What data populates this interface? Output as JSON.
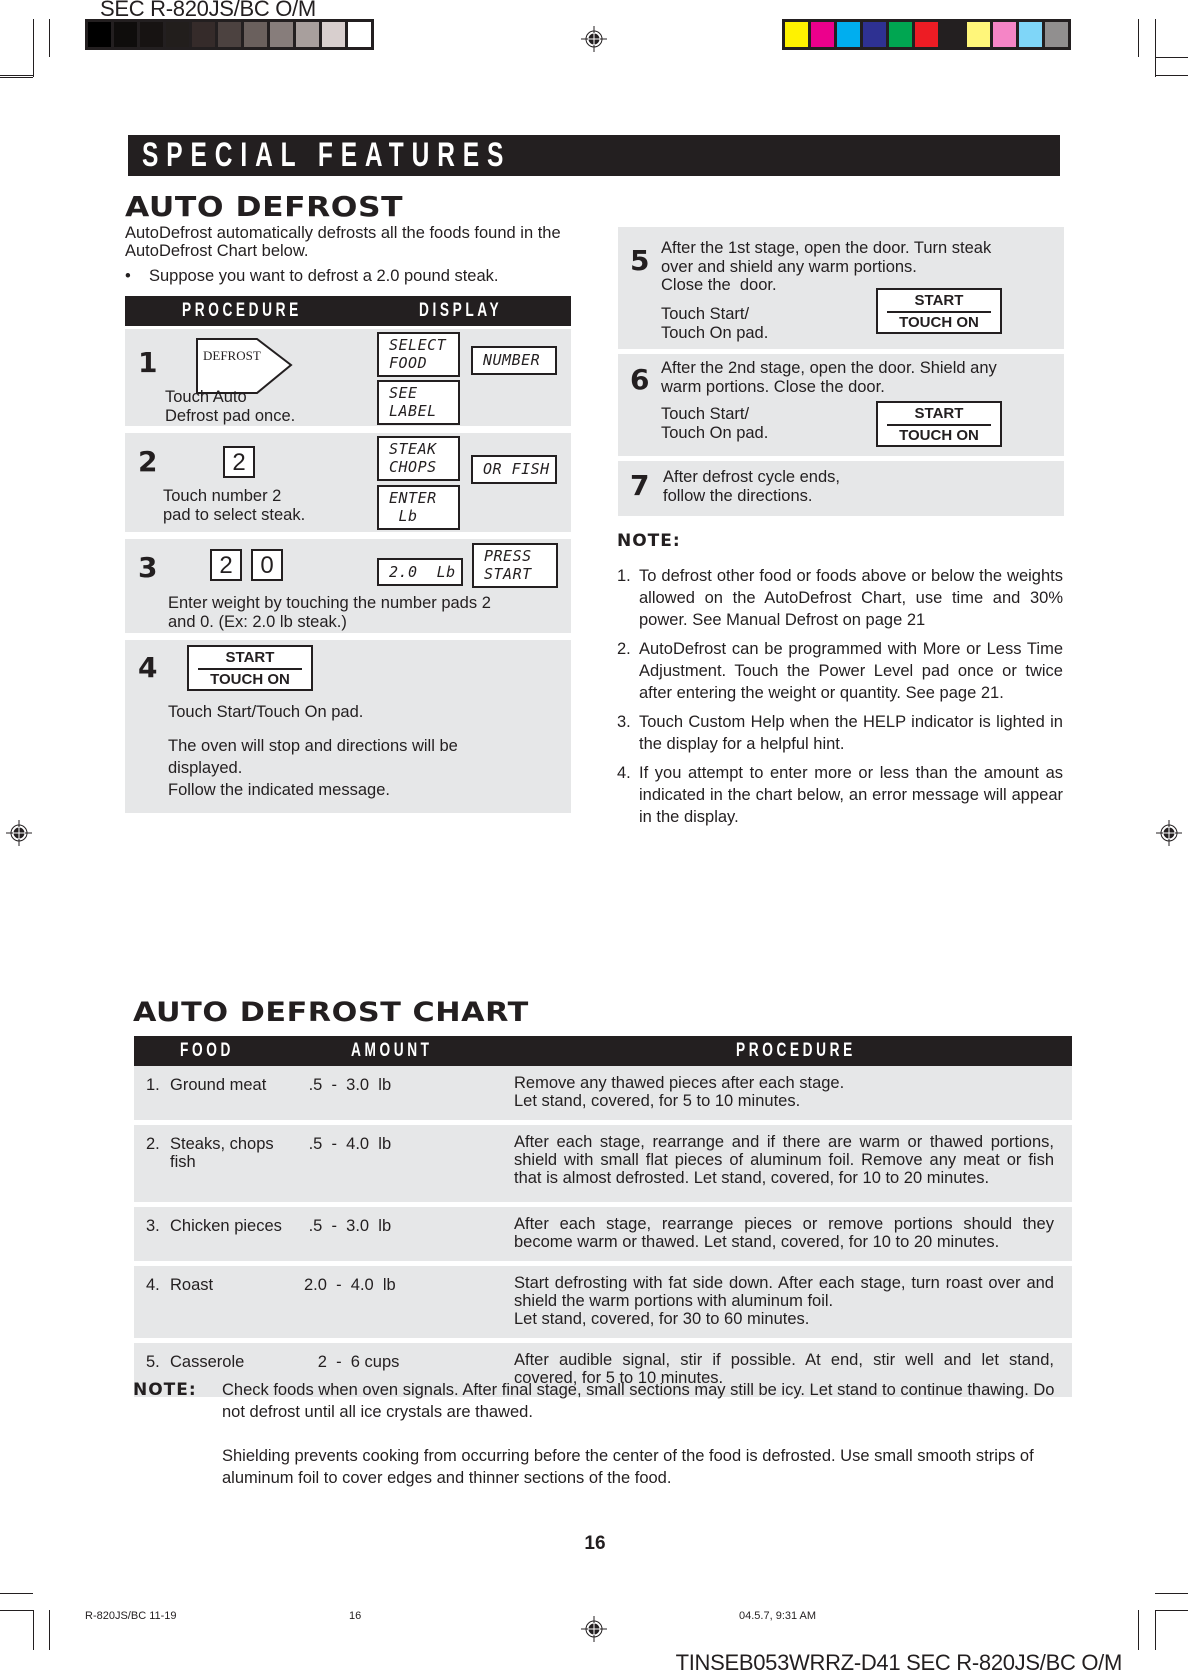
{
  "print_marks": {
    "header_code": "SEC R-820JS/BC O/M",
    "gray_swatches": [
      "#000000",
      "#0f0d0c",
      "#171312",
      "#221e1c",
      "#352b2a",
      "#4c4240",
      "#6a605d",
      "#877d7b",
      "#a89f9d",
      "#d8cfce",
      "#ffffff"
    ],
    "color_swatches": [
      "#fff200",
      "#ec008c",
      "#00aeef",
      "#2e3192",
      "#00a651",
      "#ed1c24",
      "#231f20",
      "#fff67a",
      "#f585c6",
      "#7fd6f8",
      "#918f8f"
    ],
    "footer_left": "R-820JS/BC 11-19",
    "footer_page": "16",
    "footer_date": "04.5.7, 9:31 AM",
    "footer_code": "TINSEB053WRRZ-D41 SEC R-820JS/BC O/M"
  },
  "section_banner": "SPECIAL FEATURES",
  "auto_defrost": {
    "title": "AUTO DEFROST",
    "intro": "AutoDefrost automatically defrosts all the foods found in the AutoDefrost Chart below.",
    "bullet_symbol": "•",
    "bullet": "Suppose you want to defrost a 2.0 pound steak.",
    "table_headers": {
      "procedure": "PROCEDURE",
      "display": "DISPLAY"
    },
    "steps": [
      {
        "num": "1",
        "pad_label": "DEFROST",
        "text": "Touch Auto\nDefrost pad once.",
        "display": [
          "SELECT\nFOOD",
          "NUMBER",
          "SEE\nLABEL"
        ]
      },
      {
        "num": "2",
        "pads": [
          "2"
        ],
        "text": "Touch number 2\npad to select steak.",
        "display": [
          "STEAK\nCHOPS",
          "OR FISH",
          "ENTER\n Lb"
        ]
      },
      {
        "num": "3",
        "pads": [
          "2",
          "0"
        ],
        "text": "Enter weight by touching the number pads 2\nand 0. (Ex: 2.0 lb steak.)",
        "display": [
          "2.0  Lb",
          "PRESS\nSTART"
        ]
      },
      {
        "num": "4",
        "button_top": "START",
        "button_bottom": "TOUCH ON",
        "text": "Touch Start/Touch On pad.",
        "text2": "The oven will stop and directions will be\ndisplayed.\nFollow the indicated message."
      },
      {
        "num": "5",
        "text": "After the 1st stage, open the door. Turn steak\nover and shield any warm portions.\nClose the  door.",
        "text2": "Touch Start/\nTouch On pad.",
        "button_top": "START",
        "button_bottom": "TOUCH ON"
      },
      {
        "num": "6",
        "text": "After the 2nd stage, open the door. Shield any\nwarm portions. Close the door.",
        "text2": "Touch Start/\nTouch On pad.",
        "button_top": "START",
        "button_bottom": "TOUCH ON"
      },
      {
        "num": "7",
        "text": "After defrost cycle ends,\nfollow the directions."
      }
    ],
    "note": {
      "title": "NOTE:",
      "items": [
        {
          "n": "1.",
          "text": "To defrost other food or foods above or below the weights allowed on the AutoDefrost Chart, use time and 30% power. See Manual Defrost on page 21"
        },
        {
          "n": "2.",
          "text": "AutoDefrost can be programmed with More or Less Time Adjustment. Touch the Power Level pad once or twice after entering the weight or quantity. See page 21."
        },
        {
          "n": "3.",
          "text": "Touch Custom Help when the HELP indicator is lighted in the display for a helpful hint."
        },
        {
          "n": "4.",
          "text": "If you attempt to enter more or less than the amount as indicated in the chart below, an error message will appear in the display."
        }
      ]
    }
  },
  "chart": {
    "title": "AUTO DEFROST CHART",
    "headers": {
      "food": "FOOD",
      "amount": "AMOUNT",
      "procedure": "PROCEDURE"
    },
    "rows": [
      {
        "n": "1.",
        "food": "Ground meat",
        "amount": " .5  -  3.0  lb",
        "procedure": "Remove any thawed pieces after each stage.\nLet stand, covered, for 5 to 10 minutes."
      },
      {
        "n": "2.",
        "food": "Steaks, chops\nfish",
        "amount": " .5  -  4.0  lb",
        "procedure": "After each stage, rearrange and if there are warm or thawed portions, shield with small flat pieces of aluminum foil. Remove any meat or fish that is almost defrosted. Let stand, covered, for 10 to 20 minutes."
      },
      {
        "n": "3.",
        "food": "Chicken pieces",
        "amount": " .5  -  3.0  lb",
        "procedure": "After each stage, rearrange pieces or remove portions should they become warm or thawed. Let stand, covered, for 10 to 20 minutes."
      },
      {
        "n": "4.",
        "food": "Roast",
        "amount": "2.0  -  4.0  lb",
        "procedure": "Start defrosting with fat side down. After each stage, turn roast over and shield the warm portions with aluminum foil.\nLet stand, covered, for 30 to 60 minutes."
      },
      {
        "n": "5.",
        "food": "Casserole",
        "amount": "   2  -  6 cups",
        "procedure": "After audible signal, stir if possible. At end, stir well and let stand, covered, for 5 to 10 minutes."
      }
    ],
    "note_label": "NOTE:",
    "note_paragraphs": [
      "Check foods when oven signals. After final stage, small sections may still be icy. Let stand to continue thawing. Do not defrost until all ice crystals are thawed.",
      "Shielding prevents cooking from occurring before the center of the food is defrosted. Use small smooth strips of aluminum foil to cover edges and thinner sections of the food."
    ]
  },
  "page_number": "16"
}
